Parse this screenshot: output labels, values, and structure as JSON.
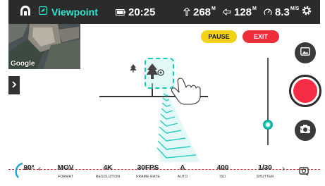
{
  "status": {
    "mode": "Viewpoint",
    "time": "20:25",
    "height": "268",
    "height_unit": "M",
    "distance": "128",
    "distance_unit": "M",
    "speed": "8.3",
    "speed_unit": "M/S",
    "icons": [
      "home-icon",
      "viewpoint-mode-icon",
      "battery-icon",
      "altitude-icon",
      "distance-icon",
      "speedometer-icon",
      "gear-icon"
    ]
  },
  "map": {
    "attribution": "Google"
  },
  "controls": {
    "pause_label": "PAUSE",
    "exit_label": "EXIT",
    "icons": [
      "gallery-icon",
      "shutter-button",
      "camera-switch-icon",
      "expand-chevron-icon"
    ]
  },
  "params": {
    "gimbal_angle": "90°",
    "format": {
      "value": "MOV",
      "label": "FORMAT"
    },
    "resolution": {
      "value": "4K",
      "label": "RESOLUTION"
    },
    "frame_rate": {
      "value": "30FPS",
      "label": "FRAME RATE"
    },
    "white_balance": {
      "value": "A",
      "label": "AUTO"
    },
    "iso": {
      "value": "400",
      "label": "ISO"
    },
    "shutter": {
      "value": "1/30",
      "label": "SHUTTER"
    }
  },
  "colors": {
    "accent": "#1ED6C4",
    "pause": "#F3D116",
    "exit": "#EF2D3A",
    "shutter": "#F52D45",
    "status_bar": "#2B2B2B"
  }
}
